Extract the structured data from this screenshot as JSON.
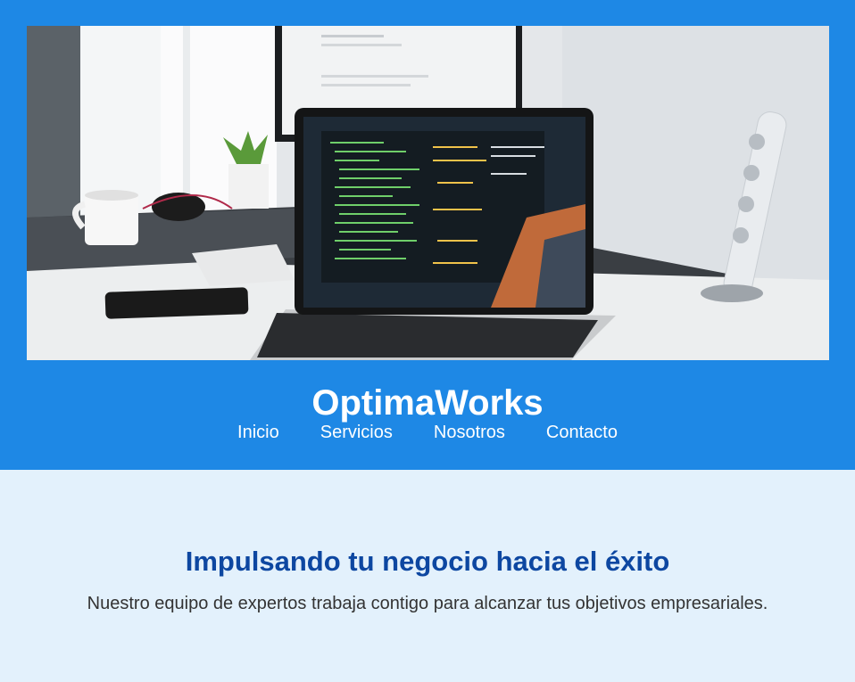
{
  "header": {
    "brand": "OptimaWorks",
    "nav": [
      {
        "label": "Inicio"
      },
      {
        "label": "Servicios"
      },
      {
        "label": "Nosotros"
      },
      {
        "label": "Contacto"
      }
    ],
    "hero_image": "laptop-on-desk-with-code-editor"
  },
  "main": {
    "headline": "Impulsando tu negocio hacia el éxito",
    "subline": "Nuestro equipo de expertos trabaja contigo para alcanzar tus objetivos empresariales."
  },
  "colors": {
    "header_bg": "#1e88e5",
    "page_bg": "#e3f1fc",
    "headline": "#0d47a1",
    "body_text": "#333333"
  }
}
